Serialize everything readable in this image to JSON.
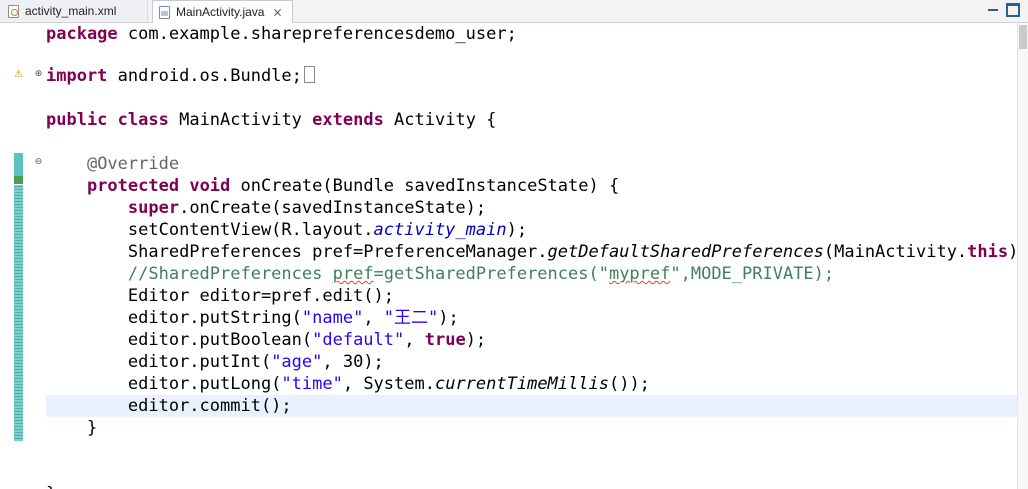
{
  "tabs": [
    {
      "label": "activity_main.xml",
      "icon": "xml-file-icon",
      "active": false
    },
    {
      "label": "MainActivity.java",
      "icon": "java-file-icon",
      "active": true,
      "close": "⨯"
    }
  ],
  "colors": {
    "keyword": "#7f0055",
    "string": "#2a00ff",
    "comment": "#3f7f5f",
    "annotation": "#646464",
    "field": "#0000c0",
    "current_line": "#e8f2fe",
    "change_ruler": "#5ec2c0"
  },
  "code": {
    "l1": {
      "kw": "package",
      "rest": " com.example.sharepreferencesdemo_user;"
    },
    "l3": {
      "kw": "import",
      "rest": " android.os.Bundle;"
    },
    "l5": {
      "kw1": "public",
      "kw2": "class",
      "name": " MainActivity ",
      "kw3": "extends",
      "rest": " Activity {"
    },
    "l7": {
      "indent": "    ",
      "ann": "@Override"
    },
    "l8": {
      "indent": "    ",
      "kw1": "protected",
      "kw2": "void",
      "rest": " onCreate(Bundle savedInstanceState) {"
    },
    "l9": {
      "indent": "        ",
      "kw": "super",
      "rest": ".onCreate(savedInstanceState);"
    },
    "l10": {
      "indent": "        ",
      "pre": "setContentView(R.layout.",
      "field": "activity_main",
      "post": ");"
    },
    "l11": {
      "indent": "        ",
      "pre": "SharedPreferences pref=PreferenceManager.",
      "method": "getDefaultSharedPreferences",
      "mid": "(MainActivity.",
      "kw": "this",
      "post": ");"
    },
    "l12": {
      "indent": "        ",
      "c1": "//SharedPreferences ",
      "c2": "pref",
      "c3": "=getSharedPreferences(\"",
      "c4": "mypref",
      "c5": "\",MODE_PRIVATE);"
    },
    "l13": {
      "indent": "        ",
      "text": "Editor editor=pref.edit();"
    },
    "l14": {
      "indent": "        ",
      "pre": "editor.putString(",
      "s1": "\"name\"",
      "mid": ", ",
      "s2": "\"王二\"",
      "post": ");"
    },
    "l15": {
      "indent": "        ",
      "pre": "editor.putBoolean(",
      "s1": "\"default\"",
      "mid": ", ",
      "kw": "true",
      "post": ");"
    },
    "l16": {
      "indent": "        ",
      "pre": "editor.putInt(",
      "s1": "\"age\"",
      "post": ", 30);"
    },
    "l17": {
      "indent": "        ",
      "pre": "editor.putLong(",
      "s1": "\"time\"",
      "mid": ", System.",
      "method": "currentTimeMillis",
      "post": "());"
    },
    "l18": {
      "indent": "        ",
      "text": "editor.commit();"
    },
    "l19": {
      "indent": "    ",
      "text": "}"
    },
    "l22": {
      "text": "}"
    }
  },
  "gutter": {
    "fold_collapsed": "⊕",
    "fold_expanded": "⊖",
    "warning": "warning-lightbulb-icon"
  }
}
